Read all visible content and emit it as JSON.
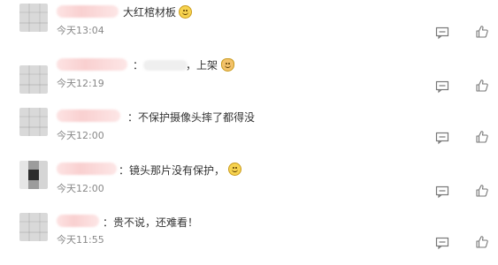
{
  "comments": [
    {
      "text": "大红棺材板",
      "time": "今天13:04"
    },
    {
      "text": "：",
      "text2": "，上架",
      "time": "今天12:19"
    },
    {
      "text": "：不保护摄像头摔了都得没",
      "time": "今天12:00"
    },
    {
      "text": "：镜头那片没有保护，",
      "time": "今天12:00"
    },
    {
      "text": "：贵不说，还难看！",
      "time": "今天11:55"
    }
  ],
  "icons": {
    "reply": "comment-reply-icon",
    "like": "thumbs-up-icon",
    "emoji": "smiley-emoji-icon"
  }
}
